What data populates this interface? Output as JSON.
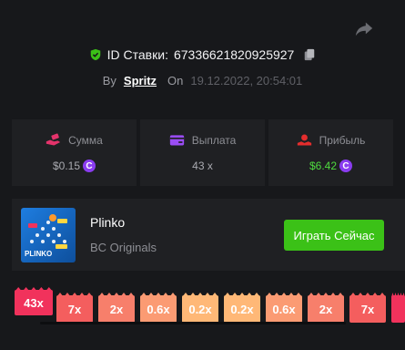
{
  "bet": {
    "id_label": "ID Ставки:",
    "id_value": "67336621820925927",
    "by_label": "By",
    "user": "Spritz",
    "on_label": "On",
    "date": "19.12.2022, 20:54:01"
  },
  "stats": [
    {
      "label": "Сумма",
      "value": "$0.15",
      "coin": "C",
      "icon": "money-hand-icon",
      "icon_color": "#e4336b"
    },
    {
      "label": "Выплата",
      "value": "43 x",
      "coin": "",
      "icon": "card-icon",
      "icon_color": "#9b4df5"
    },
    {
      "label": "Прибыль",
      "value": "$6.42",
      "coin": "C",
      "icon": "profit-person-icon",
      "icon_color": "#e42d2d"
    }
  ],
  "game": {
    "title": "Plinko",
    "provider": "BC Originals",
    "play_label": "Играть Сейчас",
    "thumb_text": "PLINKO",
    "accent_color": "#3bc117"
  },
  "buckets": [
    {
      "label": "43x",
      "color": "#f1325c"
    },
    {
      "label": "7x",
      "color": "#f45e5e"
    },
    {
      "label": "2x",
      "color": "#f77f6b"
    },
    {
      "label": "0.6x",
      "color": "#fb9b73"
    },
    {
      "label": "0.2x",
      "color": "#ffb877"
    },
    {
      "label": "0.2x",
      "color": "#ffb877"
    },
    {
      "label": "0.6x",
      "color": "#fb9b73"
    },
    {
      "label": "2x",
      "color": "#f77f6b"
    },
    {
      "label": "7x",
      "color": "#f45e5e"
    }
  ]
}
